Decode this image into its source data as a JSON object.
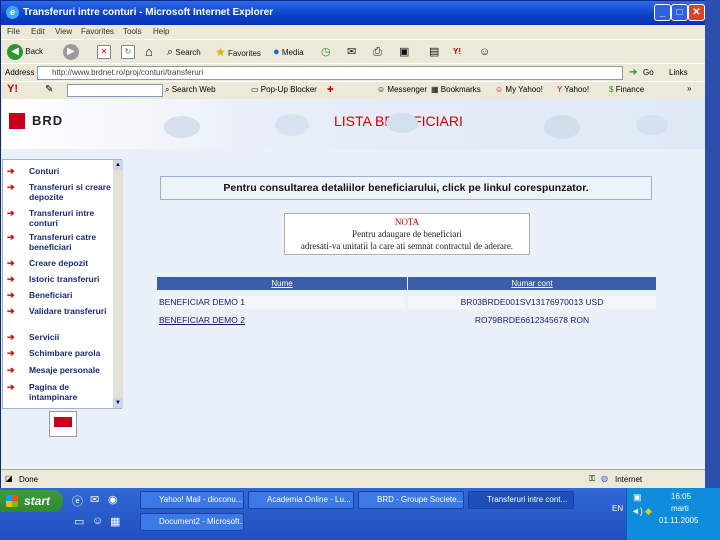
{
  "window": {
    "title": "Transferuri intre conturi - Microsoft Internet Explorer"
  },
  "menu": [
    "File",
    "Edit",
    "View",
    "Favorites",
    "Tools",
    "Help"
  ],
  "toolbar": {
    "back": "Back",
    "search": "Search",
    "favorites": "Favorites",
    "media": "Media"
  },
  "address": {
    "label": "Address",
    "url": "http://www.brdnet.ro/proj/conturi/transferuri",
    "go": "Go",
    "links": "Links"
  },
  "yahoo": {
    "search_web": "Search Web",
    "popup_blocker": "Pop-Up Blocker",
    "messenger": "Messenger",
    "bookmarks": "Bookmarks",
    "my_yahoo": "My Yahoo!",
    "yahoo": "Yahoo!",
    "finance": "Finance"
  },
  "brand": {
    "name": "BRD",
    "heading": "LISTA BENEFICIARI"
  },
  "sidebar": {
    "items": [
      "Conturi",
      "Transferuri si creare depozite",
      "Transferuri intre conturi",
      "Transferuri catre beneficiari",
      "Creare depozit",
      "Istoric transferuri",
      "Beneficiari",
      "Validare transferuri",
      "Servicii",
      "Schimbare parola",
      "Mesaje personale",
      "Pagina de intampinare"
    ]
  },
  "info": {
    "text": "Pentru consultarea detaliilor beneficiarului, click pe linkul corespunzator."
  },
  "note": {
    "title": "NOTA",
    "line1": "Pentru adaugare de beneficiari",
    "line2": "adresati-va unitatii la care ati semnat contractul de aderare."
  },
  "table": {
    "headers": [
      "Nume",
      "Numar cont"
    ],
    "rows": [
      [
        "BENEFICIAR DEMO 1",
        "BR03BRDE001SV13176970013 USD"
      ],
      [
        "BENEFICIAR DEMO 2",
        "RO79BRDE6612345678 RON"
      ]
    ]
  },
  "status": {
    "left": "Done",
    "zone": "Internet"
  },
  "taskbar": {
    "start": "start",
    "tasks": [
      "Yahoo! Mail - dioconu...",
      "Academia Online - Lu...",
      "BRD - Groupe Societe...",
      "Transferuri intre cont...",
      "Document2 - Microsoft..."
    ],
    "lang": "EN",
    "time": "16:05",
    "day": "marti",
    "date": "01.11.2005"
  },
  "colors": {
    "brand_red": "#c8001e",
    "heading_red": "#d40000",
    "header_blue": "#3b5ea8"
  }
}
